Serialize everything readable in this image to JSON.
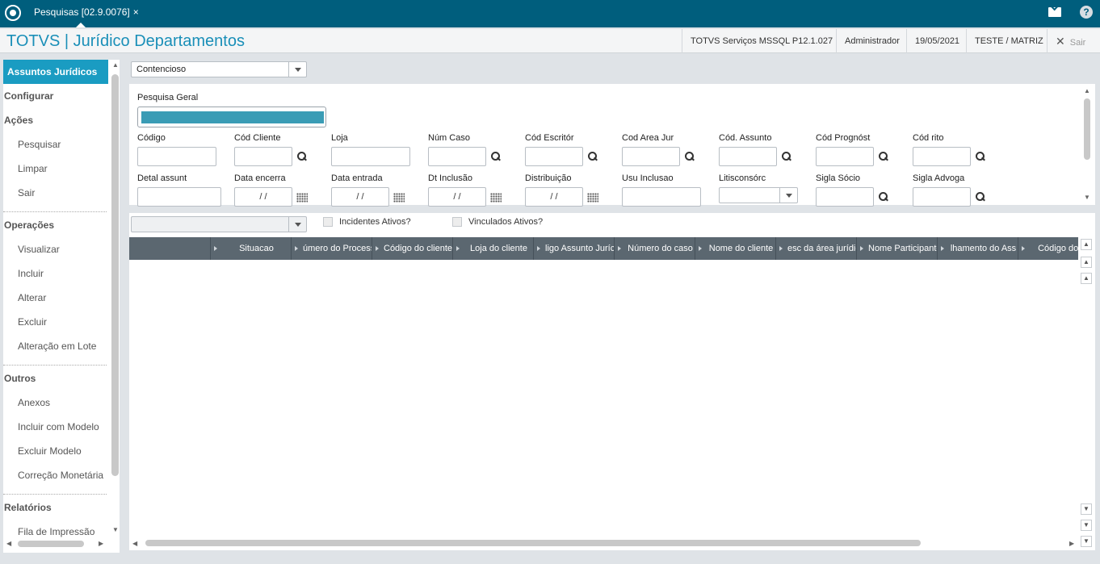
{
  "tab": {
    "label": "Pesquisas [02.9.0076]",
    "close": "×"
  },
  "header": {
    "title": "TOTVS | Jurídico Departamentos",
    "env": "TOTVS Serviços MSSQL P12.1.027",
    "user": "Administrador",
    "date": "19/05/2021",
    "branch": "TESTE / MATRIZ",
    "logout": "Sair"
  },
  "sidebar": {
    "active": "Assuntos Jurídicos",
    "configurar": "Configurar",
    "acoes": {
      "title": "Ações",
      "items": [
        "Pesquisar",
        "Limpar",
        "Sair"
      ]
    },
    "operacoes": {
      "title": "Operações",
      "items": [
        "Visualizar",
        "Incluir",
        "Alterar",
        "Excluir",
        "Alteração em Lote"
      ]
    },
    "outros": {
      "title": "Outros",
      "items": [
        "Anexos",
        "Incluir com Modelo",
        "Excluir Modelo",
        "Correção Monetária"
      ]
    },
    "relatorios": {
      "title": "Relatórios",
      "items": [
        "Fila de Impressão"
      ]
    }
  },
  "type_select": {
    "value": "Contencioso"
  },
  "search": {
    "geral_label": "Pesquisa Geral",
    "row1": [
      "Código",
      "Cód Cliente",
      "Loja",
      "Núm Caso",
      "Cód Escritór",
      "Cod Area Jur",
      "Cód. Assunto",
      "Cód Prognóst",
      "Cód rito"
    ],
    "row2": [
      "Detal assunt",
      "Data encerra",
      "Data entrada",
      "Dt Inclusão",
      "Distribuição",
      "Usu Inclusao",
      "Litisconsórc",
      "Sigla Sócio",
      "Sigla Advoga"
    ],
    "date_mask": " /  / "
  },
  "filters": {
    "incidentes": "Incidentes Ativos?",
    "vinculados": "Vinculados Ativos?"
  },
  "grid": {
    "columns": [
      "",
      "Situacao",
      "úmero do Process",
      "Código do cliente",
      "Loja do cliente",
      "ligo Assunto Juríc",
      "Número do caso",
      "Nome do cliente",
      "esc da área jurídic",
      "Nome Participante",
      "lhamento do Ass",
      "Código do as"
    ]
  }
}
